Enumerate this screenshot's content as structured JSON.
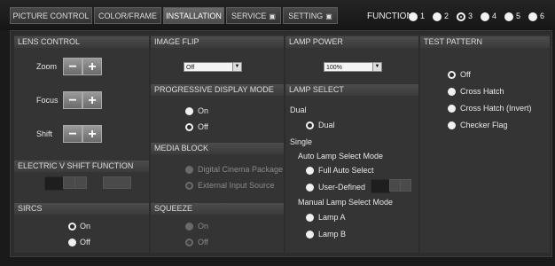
{
  "tabs": [
    {
      "label": "PICTURE CONTROL"
    },
    {
      "label": "COLOR/FRAME"
    },
    {
      "label": "INSTALLATION"
    },
    {
      "label": "SERVICE"
    },
    {
      "label": "SETTING"
    }
  ],
  "function": {
    "label": "FUNCTION",
    "items": [
      "1",
      "2",
      "3",
      "4",
      "5",
      "6"
    ],
    "selected": "3"
  },
  "lock_icon": "lock-icon",
  "lens_control": {
    "title": "LENS CONTROL",
    "zoom": "Zoom",
    "focus": "Focus",
    "shift": "Shift",
    "minus": "−",
    "plus": "+"
  },
  "electric_v_shift": {
    "title": "ELECTRIC V SHIFT FUNCTION"
  },
  "sircs": {
    "title": "SIRCS",
    "on": "On",
    "off": "Off",
    "selected": "On"
  },
  "image_flip": {
    "title": "IMAGE FLIP",
    "value": "Off"
  },
  "progressive": {
    "title": "PROGRESSIVE DISPLAY MODE",
    "on": "On",
    "off": "Off",
    "selected": "Off"
  },
  "media_block": {
    "title": "MEDIA BLOCK",
    "opt1": "Digital Cinema Package",
    "opt2": "External Input Source"
  },
  "squeeze": {
    "title": "SQUEEZE",
    "on": "On",
    "off": "Off"
  },
  "lamp_power": {
    "title": "LAMP POWER",
    "value": "100%"
  },
  "lamp_select": {
    "title": "LAMP SELECT",
    "dual_heading": "Dual",
    "dual_option": "Dual",
    "single_heading": "Single",
    "auto_heading": "Auto Lamp Select Mode",
    "full_auto": "Full Auto Select",
    "user_defined": "User-Defined",
    "manual_heading": "Manual Lamp Select Mode",
    "lamp_a": "Lamp A",
    "lamp_b": "Lamp B"
  },
  "test_pattern": {
    "title": "TEST PATTERN",
    "options": [
      "Off",
      "Cross Hatch",
      "Cross Hatch (Invert)",
      "Checker Flag"
    ],
    "selected": "Off"
  }
}
